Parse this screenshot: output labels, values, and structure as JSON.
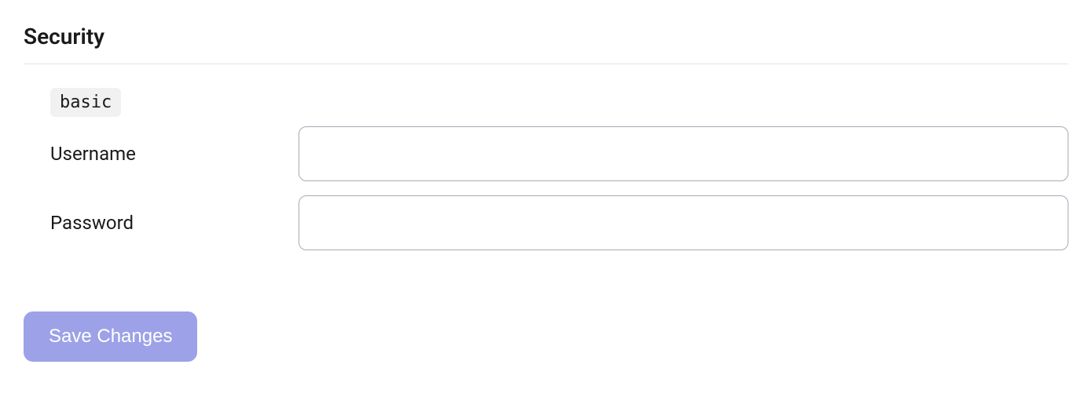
{
  "section": {
    "title": "Security",
    "badge": "basic"
  },
  "form": {
    "username": {
      "label": "Username",
      "value": ""
    },
    "password": {
      "label": "Password",
      "value": ""
    }
  },
  "actions": {
    "save_label": "Save Changes"
  }
}
